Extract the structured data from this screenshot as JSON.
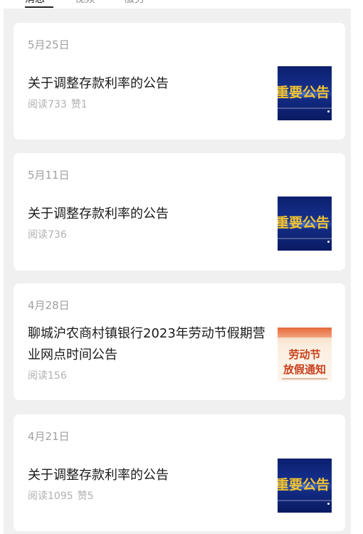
{
  "tabs": [
    {
      "label": "消息",
      "active": true
    },
    {
      "label": "视频",
      "active": false
    },
    {
      "label": "服务",
      "active": false
    }
  ],
  "articles": [
    {
      "date": "5月25日",
      "title": "关于调整存款利率的公告",
      "reads": "阅读733",
      "likes": "赞1",
      "thumbnail": {
        "type": "notice",
        "text": "重要公告"
      }
    },
    {
      "date": "5月11日",
      "title": "关于调整存款利率的公告",
      "reads": "阅读736",
      "likes": "",
      "thumbnail": {
        "type": "notice",
        "text": "重要公告"
      }
    },
    {
      "date": "4月28日",
      "title": "聊城沪农商村镇银行2023年劳动节假期营业网点时间公告",
      "reads": "阅读156",
      "likes": "",
      "thumbnail": {
        "type": "holiday",
        "line1": "劳动节",
        "line2": "放假通知"
      }
    },
    {
      "date": "4月21日",
      "title": "关于调整存款利率的公告",
      "reads": "阅读1095",
      "likes": "赞5",
      "thumbnail": {
        "type": "notice",
        "text": "重要公告"
      }
    }
  ],
  "colors": {
    "background": "#f0f0f0",
    "card": "#ffffff",
    "title": "#1a1a1a",
    "muted": "#a0a0a0",
    "notice_thumb": "#15318f",
    "notice_text": "#f4c430",
    "holiday_text": "#c8401c"
  }
}
